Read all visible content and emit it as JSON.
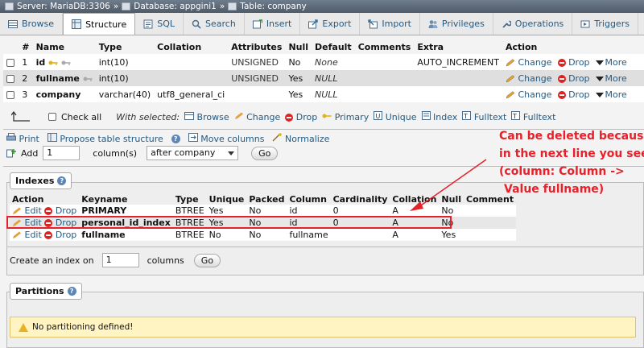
{
  "breadcrumb": {
    "server": "Server: MariaDB:3306",
    "database": "Database: appgini1",
    "table": "Table: company",
    "separator": "»"
  },
  "tabs": [
    {
      "label": "Browse",
      "icon": "browse-icon"
    },
    {
      "label": "Structure",
      "icon": "structure-icon",
      "active": true
    },
    {
      "label": "SQL",
      "icon": "sql-icon"
    },
    {
      "label": "Search",
      "icon": "search-icon"
    },
    {
      "label": "Insert",
      "icon": "insert-icon"
    },
    {
      "label": "Export",
      "icon": "export-icon"
    },
    {
      "label": "Import",
      "icon": "import-icon"
    },
    {
      "label": "Privileges",
      "icon": "privileges-icon"
    },
    {
      "label": "Operations",
      "icon": "wrench-icon"
    },
    {
      "label": "Triggers",
      "icon": "triggers-icon"
    }
  ],
  "structure": {
    "headers": [
      "#",
      "Name",
      "Type",
      "Collation",
      "Attributes",
      "Null",
      "Default",
      "Comments",
      "Extra",
      "Action"
    ],
    "rows": [
      {
        "num": "1",
        "name": "id",
        "type": "int(10)",
        "collation": "",
        "attributes": "UNSIGNED",
        "null": "No",
        "default": "None",
        "comments": "",
        "extra": "AUTO_INCREMENT"
      },
      {
        "num": "2",
        "name": "fullname",
        "type": "int(10)",
        "collation": "",
        "attributes": "UNSIGNED",
        "null": "Yes",
        "default": "NULL",
        "comments": "",
        "extra": ""
      },
      {
        "num": "3",
        "name": "company",
        "type": "varchar(40)",
        "collation": "utf8_general_ci",
        "attributes": "",
        "null": "Yes",
        "default": "NULL",
        "comments": "",
        "extra": ""
      }
    ],
    "row_actions": {
      "change": "Change",
      "drop": "Drop",
      "more": "More"
    }
  },
  "bulk": {
    "check_all": "Check all",
    "with_selected": "With selected:",
    "actions": [
      "Browse",
      "Change",
      "Drop",
      "Primary",
      "Unique",
      "Index",
      "Fulltext",
      "Fulltext"
    ]
  },
  "tools": {
    "print": "Print",
    "propose": "Propose table structure",
    "move_columns": "Move columns",
    "normalize": "Normalize"
  },
  "add_columns": {
    "label": "Add",
    "value": "1",
    "unit": "column(s)",
    "position": "after company",
    "go": "Go"
  },
  "indexes": {
    "legend": "Indexes",
    "headers": [
      "Action",
      "Keyname",
      "Type",
      "Unique",
      "Packed",
      "Column",
      "Cardinality",
      "Collation",
      "Null",
      "Comment"
    ],
    "rows": [
      {
        "keyname": "PRIMARY",
        "type": "BTREE",
        "unique": "Yes",
        "packed": "No",
        "column": "id",
        "cardinality": "0",
        "collation": "A",
        "null": "No",
        "comment": ""
      },
      {
        "keyname": "personal_id_index",
        "type": "BTREE",
        "unique": "Yes",
        "packed": "No",
        "column": "id",
        "cardinality": "0",
        "collation": "A",
        "null": "No",
        "comment": ""
      },
      {
        "keyname": "fullname",
        "type": "BTREE",
        "unique": "No",
        "packed": "No",
        "column": "fullname",
        "cardinality": "",
        "collation": "A",
        "null": "Yes",
        "comment": ""
      }
    ],
    "edit": "Edit",
    "drop": "Drop",
    "create_label": "Create an index on",
    "create_value": "1",
    "create_unit": "columns",
    "go": "Go"
  },
  "partitions": {
    "legend": "Partitions",
    "notice": "No partitioning defined!"
  },
  "annotation": {
    "lines": [
      "Can be deleted because",
      "in the next line you see",
      "(column: Column ->",
      "Value fullname)"
    ],
    "color": "#e8202a"
  }
}
